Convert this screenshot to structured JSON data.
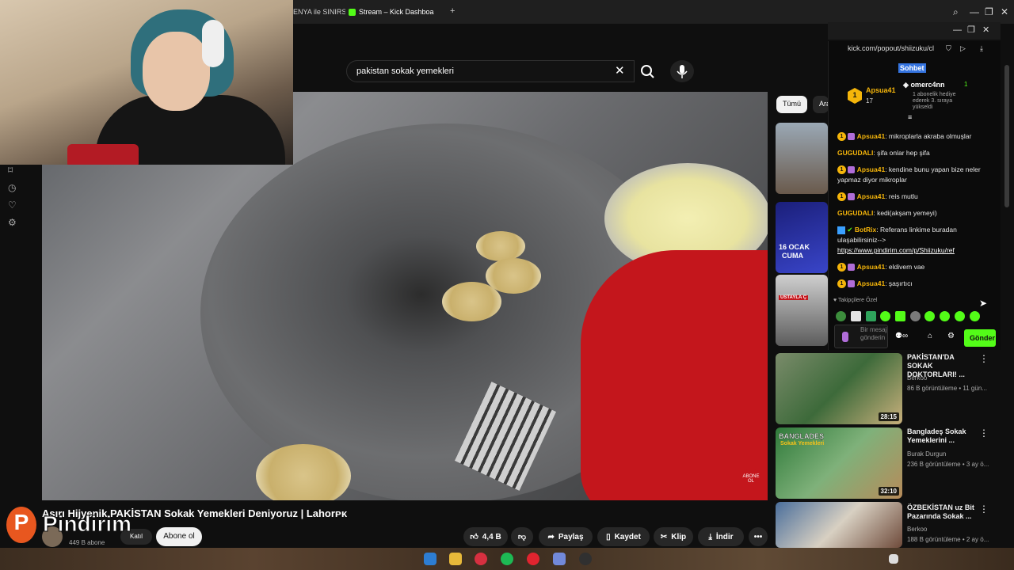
{
  "browser": {
    "tabs": [
      {
        "label": "ENYA ile SINIRS"
      },
      {
        "label": "Stream – Kick Dashboa"
      }
    ],
    "new_tab_icon": "+"
  },
  "youtube": {
    "search": {
      "value": "pakistan sokak yemekleri"
    },
    "video": {
      "title": "Aşırı Hijyenik PAKİSTAN Sokak Yemekleri Deniyoruz | Lahorᴘᴋ",
      "channel_subs": "449 B abone",
      "join_label": "Katıl",
      "subscribe_label": "Abone ol",
      "badge_label": "ABONE OL",
      "likes": "4,4 B",
      "share_label": "Paylaş",
      "save_label": "Kaydet",
      "clip_label": "Klip",
      "download_label": "İndir"
    },
    "chips": [
      {
        "label": "Tümü"
      },
      {
        "label": "Ara"
      }
    ],
    "recommendations": [
      {
        "title": "PAKİSTAN'DA SOKAK DOKTORLARI! ...",
        "channel": "Berkoo",
        "meta": "86 B görüntüleme • 11 gün...",
        "duration": "28:15"
      },
      {
        "title": "Bangladeş Sokak Yemeklerini ...",
        "channel": "Burak Durgun",
        "meta": "236 B görüntüleme • 3 ay ö...",
        "duration": "32:10",
        "thumb_text": "BANGLADEŞ",
        "thumb_sub": "Sokak Yemekleri"
      },
      {
        "title": "ÖZBEKİSTAN uz Bit Pazarında Sokak ...",
        "channel": "Berkoo",
        "meta": "188 B görüntüleme • 2 ay ö..."
      }
    ],
    "thumb_labels": {
      "date": "16 OCAK",
      "day": "CUMA",
      "overlay": "USTAYLA Ç"
    }
  },
  "overlay": {
    "brand": "Pindirim"
  },
  "chat": {
    "url": "kick.com/popout/shiizuku/cl",
    "tab_label": "Sohbet",
    "pinned": {
      "user": "Apsua41",
      "rank": "1",
      "count": "17",
      "gifter": "omerc4nn",
      "gifter_rank": "1",
      "gift_text": "1 abonelik hediye ederek 3. sıraya yükseldi"
    },
    "messages": [
      {
        "user": "Apsua41",
        "color": "#f5b50a",
        "text": "mikroplarla akraba olmuşlar"
      },
      {
        "user": "GUGUDALI",
        "color": "#f5b50a",
        "text": "şifa onlar hep şifa"
      },
      {
        "user": "Apsua41",
        "color": "#f5b50a",
        "text": "kendine bunu yapan bize neler yapmaz diyor mikroplar"
      },
      {
        "user": "Apsua41",
        "color": "#f5b50a",
        "text": "reis mutlu"
      },
      {
        "user": "GUGUDALI",
        "color": "#f5b50a",
        "text": "kedi(akşam yemeyi)"
      },
      {
        "user": "BotRix",
        "color": "#f5b50a",
        "text": "Referans linkime buradan ulaşabilirsiniz-->"
      },
      {
        "user": "Apsua41",
        "color": "#f5b50a",
        "text": "eldivem vae"
      },
      {
        "user": "Apsua41",
        "color": "#f5b50a",
        "text": "şaşırtıcı"
      }
    ],
    "botrix_link": "https://www.pindirim.com/p/Shiizuku/ref",
    "followers_label": "Takipçilere Özel",
    "input_placeholder": "Bir mesaj gönderin",
    "send_label": "Gönder"
  }
}
